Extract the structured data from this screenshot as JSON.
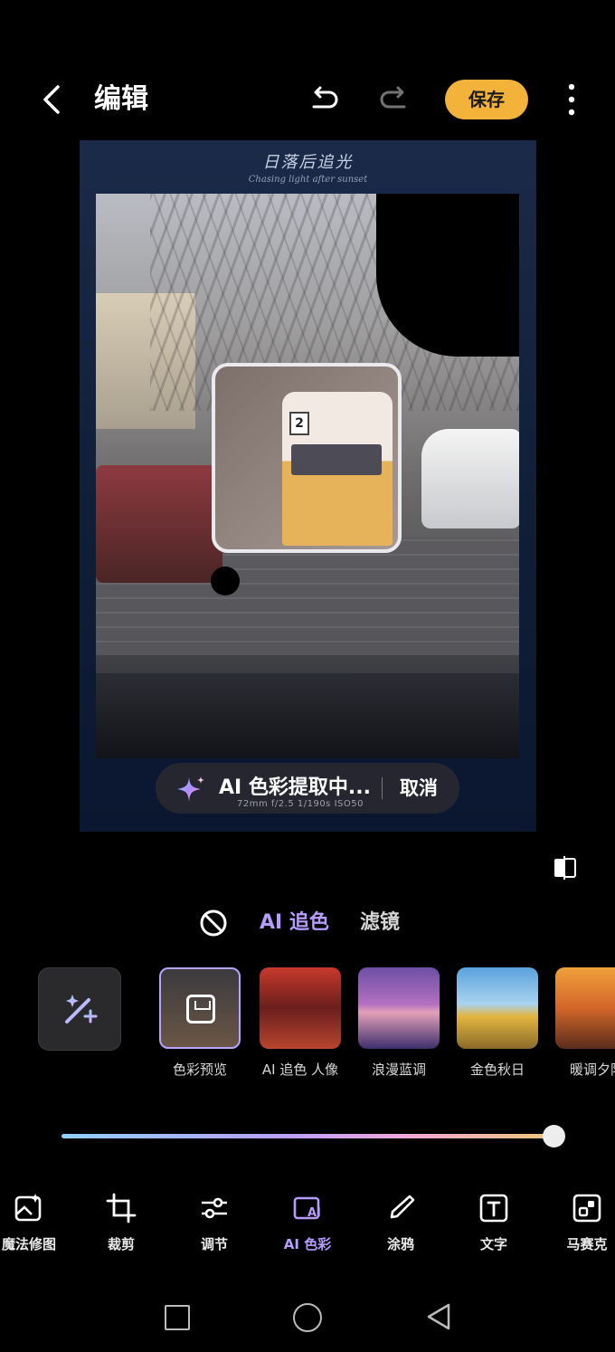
{
  "header": {
    "back_icon": "chevron-left-icon",
    "title": "编辑",
    "save_label": "保存"
  },
  "canvas": {
    "signature_line1": "日落后追光",
    "signature_line2": "Chasing light after sunset",
    "status_text": "AI 色彩提取中...",
    "cancel_label": "取消",
    "camera_meta": "72mm  f/2.5  1/190s  ISO50"
  },
  "tabs": {
    "ai_label": "AI 追色",
    "filter_label": "滤镜"
  },
  "presets": [
    {
      "label": "色彩预览"
    },
    {
      "label": "AI 追色 人像"
    },
    {
      "label": "浪漫蓝调"
    },
    {
      "label": "金色秋日"
    },
    {
      "label": "暖调夕阳"
    }
  ],
  "slider": {
    "value_fraction": 1.0
  },
  "tools": [
    {
      "label": "魔法修图",
      "icon": "magic-image-icon"
    },
    {
      "label": "裁剪",
      "icon": "crop-icon"
    },
    {
      "label": "调节",
      "icon": "sliders-icon"
    },
    {
      "label": "AI 色彩",
      "icon": "ai-color-icon",
      "active": true
    },
    {
      "label": "涂鸦",
      "icon": "brush-icon"
    },
    {
      "label": "文字",
      "icon": "text-icon"
    },
    {
      "label": "马赛克",
      "icon": "mosaic-icon"
    }
  ],
  "colors": {
    "accent": "#f3b23a",
    "active": "#b79cff"
  }
}
